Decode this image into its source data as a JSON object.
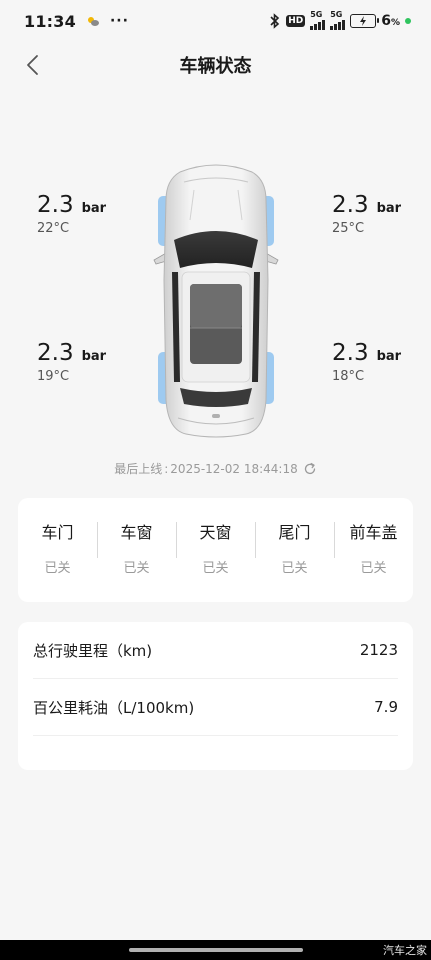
{
  "status_bar": {
    "time": "11:34",
    "more": "···",
    "hd": "HD",
    "signal_1": "5G",
    "signal_2": "5G",
    "battery_percent": "6",
    "battery_suffix": "%",
    "charge_dot_color": "#2fc45e"
  },
  "header": {
    "title": "车辆状态",
    "back_icon": "chevron-left-icon"
  },
  "tyres": {
    "front_left": {
      "pressure": "2.3",
      "unit": "bar",
      "temp": "22°C"
    },
    "front_right": {
      "pressure": "2.3",
      "unit": "bar",
      "temp": "25°C"
    },
    "rear_left": {
      "pressure": "2.3",
      "unit": "bar",
      "temp": "19°C"
    },
    "rear_right": {
      "pressure": "2.3",
      "unit": "bar",
      "temp": "18°C"
    },
    "highlight_color": "#8ec2ef"
  },
  "last_online": {
    "label": "最后上线",
    "separator": ":",
    "value": "2025-12-02 18:44:18"
  },
  "body_status": [
    {
      "name": "车门",
      "state": "已关"
    },
    {
      "name": "车窗",
      "state": "已关"
    },
    {
      "name": "天窗",
      "state": "已关"
    },
    {
      "name": "尾门",
      "state": "已关"
    },
    {
      "name": "前车盖",
      "state": "已关"
    }
  ],
  "stats": [
    {
      "label": "总行驶里程（km)",
      "value": "2123"
    },
    {
      "label": "百公里耗油（L/100km)",
      "value": "7.9"
    }
  ],
  "watermark": "汽车之家"
}
